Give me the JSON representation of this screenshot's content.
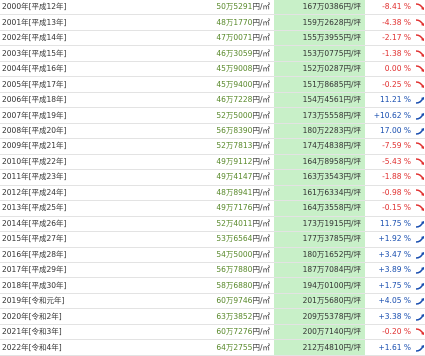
{
  "colors": {
    "negative": "#e03030",
    "positive": "#1a4fb0",
    "tsubo_bg": "#c8f0c8",
    "price_number": "#5a8a2c"
  },
  "units": {
    "price_unit": "円/㎡",
    "tsubo_unit": "円/坪"
  },
  "rows": [
    {
      "year": "2000年[平成12年]",
      "price": "50万5291",
      "tsubo": "167万0386",
      "change": "-8.41 %",
      "trend": "down"
    },
    {
      "year": "2001年[平成13年]",
      "price": "48万1770",
      "tsubo": "159万2628",
      "change": "-4.38 %",
      "trend": "down"
    },
    {
      "year": "2002年[平成14年]",
      "price": "47万0071",
      "tsubo": "155万3955",
      "change": "-2.17 %",
      "trend": "down"
    },
    {
      "year": "2003年[平成15年]",
      "price": "46万3059",
      "tsubo": "153万0775",
      "change": "-1.38 %",
      "trend": "down"
    },
    {
      "year": "2004年[平成16年]",
      "price": "45万9008",
      "tsubo": "152万0287",
      "change": "0.00 %",
      "trend": "down"
    },
    {
      "year": "2005年[平成17年]",
      "price": "45万9400",
      "tsubo": "151万8685",
      "change": "-0.25 %",
      "trend": "down"
    },
    {
      "year": "2006年[平成18年]",
      "price": "46万7228",
      "tsubo": "154万4561",
      "change": "11.21 %",
      "trend": "up"
    },
    {
      "year": "2007年[平成19年]",
      "price": "52万5000",
      "tsubo": "173万5558",
      "change": "+10.62 %",
      "trend": "up"
    },
    {
      "year": "2008年[平成20年]",
      "price": "56万8390",
      "tsubo": "180万2283",
      "change": "17.00 %",
      "trend": "up"
    },
    {
      "year": "2009年[平成21年]",
      "price": "52万7813",
      "tsubo": "174万4838",
      "change": "-7.59 %",
      "trend": "down"
    },
    {
      "year": "2010年[平成22年]",
      "price": "49万9112",
      "tsubo": "164万8958",
      "change": "-5.43 %",
      "trend": "down"
    },
    {
      "year": "2011年[平成23年]",
      "price": "49万4147",
      "tsubo": "163万3543",
      "change": "-1.88 %",
      "trend": "down"
    },
    {
      "year": "2012年[平成24年]",
      "price": "48万8941",
      "tsubo": "161万6334",
      "change": "-0.98 %",
      "trend": "down"
    },
    {
      "year": "2013年[平成25年]",
      "price": "49万7176",
      "tsubo": "164万3558",
      "change": "-0.15 %",
      "trend": "down"
    },
    {
      "year": "2014年[平成26年]",
      "price": "52万4011",
      "tsubo": "173万1915",
      "change": "11.75 %",
      "trend": "up"
    },
    {
      "year": "2015年[平成27年]",
      "price": "53万6564",
      "tsubo": "177万3785",
      "change": "+1.92 %",
      "trend": "up"
    },
    {
      "year": "2016年[平成28年]",
      "price": "54万5000",
      "tsubo": "180万1652",
      "change": "+3.47 %",
      "trend": "up"
    },
    {
      "year": "2017年[平成29年]",
      "price": "56万7880",
      "tsubo": "187万7084",
      "change": "+3.89 %",
      "trend": "up"
    },
    {
      "year": "2018年[平成30年]",
      "price": "58万6880",
      "tsubo": "194万0100",
      "change": "+1.75 %",
      "trend": "up"
    },
    {
      "year": "2019年[令和元年]",
      "price": "60万9746",
      "tsubo": "201万5680",
      "change": "+4.05 %",
      "trend": "up"
    },
    {
      "year": "2020年[令和2年]",
      "price": "63万3852",
      "tsubo": "209万5378",
      "change": "+3.38 %",
      "trend": "up"
    },
    {
      "year": "2021年[令和3年]",
      "price": "60万7276",
      "tsubo": "200万7140",
      "change": "-0.20 %",
      "trend": "down"
    },
    {
      "year": "2022年[令和4年]",
      "price": "64万2755",
      "tsubo": "212万4810",
      "change": "+1.61 %",
      "trend": "up"
    }
  ]
}
